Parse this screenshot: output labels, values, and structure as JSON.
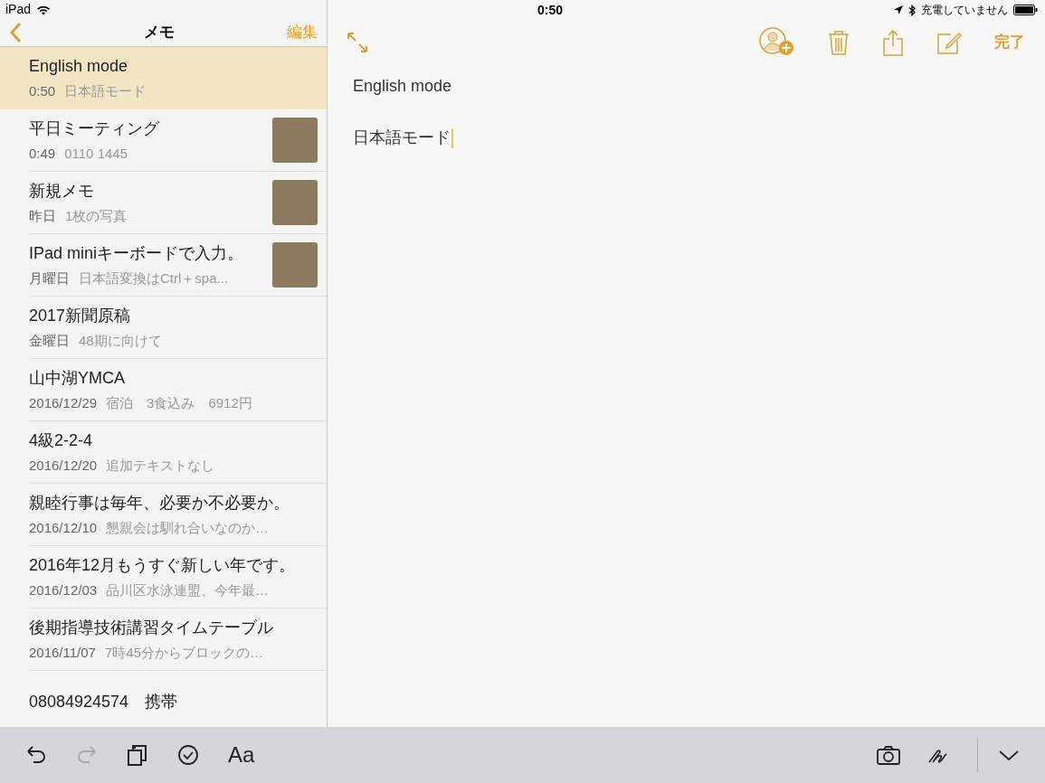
{
  "status_bar": {
    "device": "iPad",
    "time": "0:50",
    "battery_text": "充電していません"
  },
  "sidebar": {
    "title": "メモ",
    "edit": "編集",
    "notes": [
      {
        "title": "English mode",
        "time": "0:50",
        "preview": "日本語モード",
        "photo": false,
        "selected": true
      },
      {
        "title": "平日ミーティング",
        "time": "0:49",
        "preview": "0110 1445",
        "photo": true,
        "selected": false
      },
      {
        "title": "新規メモ",
        "time": "昨日",
        "preview": "1枚の写真",
        "photo": true,
        "selected": false
      },
      {
        "title": "IPad miniキーボードで入力。",
        "time": "月曜日",
        "preview": "日本語変換はCtrl＋spa...",
        "photo": true,
        "selected": false
      },
      {
        "title": "2017新聞原稿",
        "time": "金曜日",
        "preview": "48期に向けて",
        "photo": false,
        "selected": false
      },
      {
        "title": "山中湖YMCA",
        "time": "2016/12/29",
        "preview": "宿泊　3食込み　6912円",
        "photo": false,
        "selected": false
      },
      {
        "title": "4級2-2-4",
        "time": "2016/12/20",
        "preview": "追加テキストなし",
        "photo": false,
        "selected": false
      },
      {
        "title": "親睦行事は毎年、必要か不必要か。",
        "time": "2016/12/10",
        "preview": "懇親会は馴れ合いなのか…",
        "photo": false,
        "selected": false
      },
      {
        "title": "2016年12月もうすぐ新しい年です。",
        "time": "2016/12/03",
        "preview": "品川区水泳連盟、今年最…",
        "photo": false,
        "selected": false
      },
      {
        "title": "後期指導技術講習タイムテーブル",
        "time": "2016/11/07",
        "preview": "7時45分からブロックの…",
        "photo": false,
        "selected": false
      },
      {
        "title": "08084924574　携帯",
        "photo": false,
        "selected": false
      }
    ]
  },
  "editor": {
    "done": "完了",
    "lines": [
      "English mode",
      "日本語モード"
    ]
  },
  "toolbar": {
    "left": [
      {
        "kind": "undo",
        "disabled": false
      },
      {
        "kind": "redo",
        "disabled": true
      },
      {
        "kind": "copy",
        "disabled": false
      },
      {
        "kind": "checklist",
        "disabled": false
      },
      {
        "kind": "format",
        "label": "Aa",
        "disabled": false
      }
    ],
    "right": [
      {
        "kind": "camera",
        "disabled": false
      },
      {
        "kind": "sketch",
        "disabled": false
      },
      {
        "kind": "collapse",
        "disabled": false
      }
    ]
  }
}
